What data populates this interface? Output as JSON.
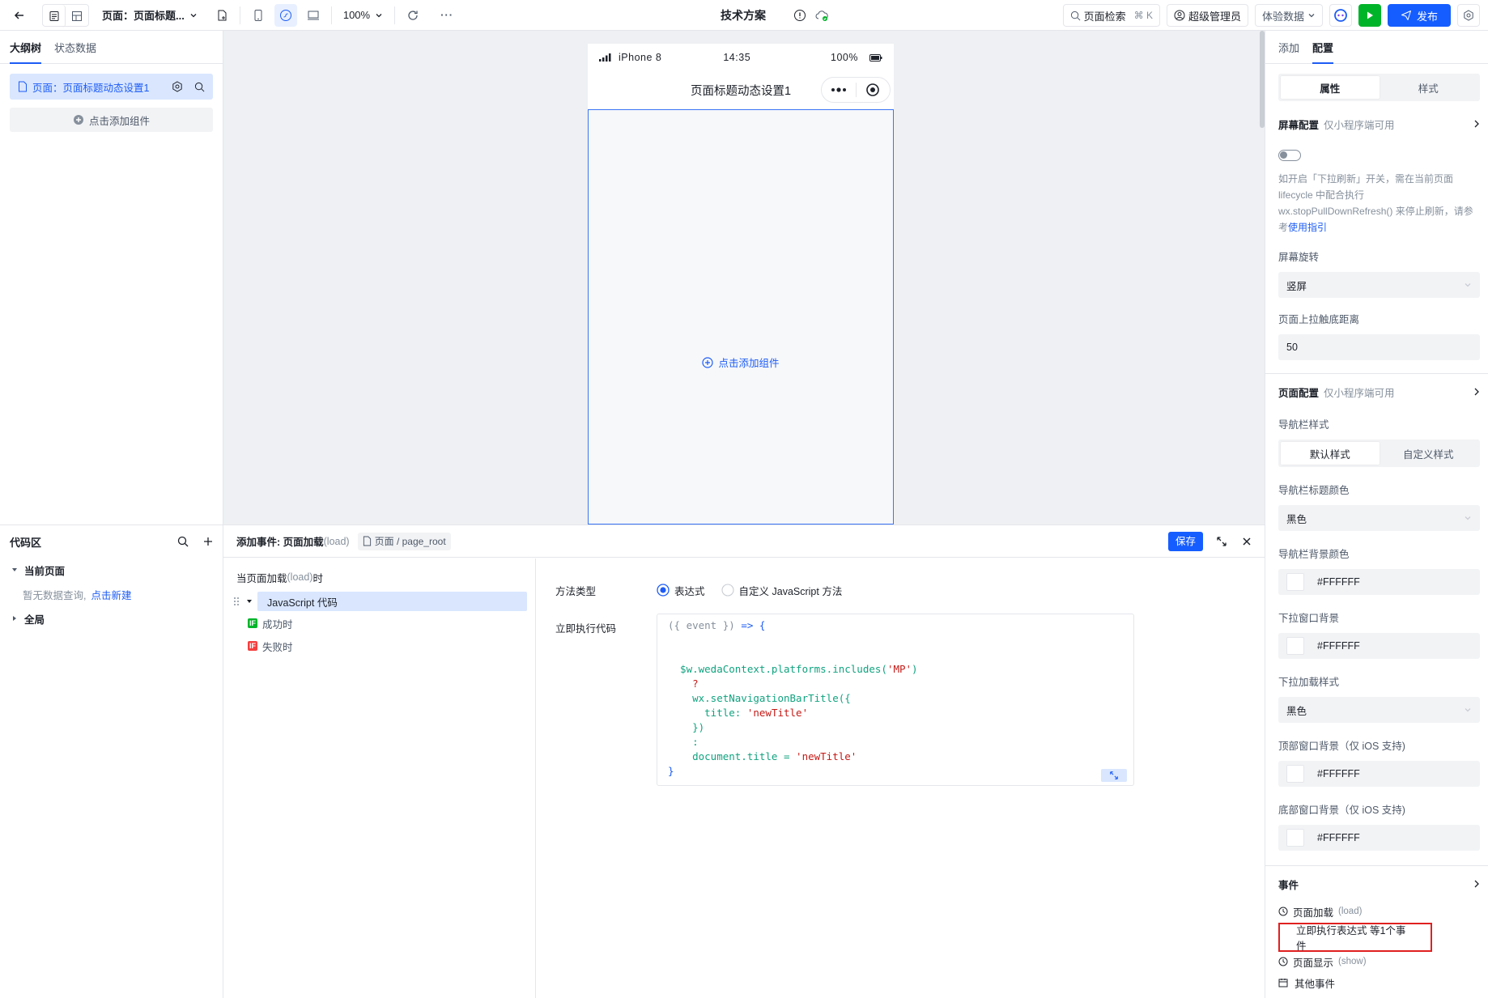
{
  "topbar": {
    "page_label": "页面：页面标题...",
    "zoom": "100%",
    "app_title": "技术方案",
    "search_label": "页面检索",
    "search_shortcut": "⌘ K",
    "user_label": "超级管理员",
    "env_label": "体验数据",
    "publish_label": "发布"
  },
  "left": {
    "tabs": [
      "大纲树",
      "状态数据"
    ],
    "page_item": "页面：页面标题动态设置1",
    "add_component": "点击添加组件",
    "code_title": "代码区",
    "current_page": "当前页面",
    "no_query": "暂无数据查询,",
    "create_new": "点击新建",
    "global": "全局"
  },
  "phone": {
    "device": "iPhone 8",
    "time": "14:35",
    "battery": "100%",
    "title": "页面标题动态设置1",
    "add_component": "点击添加组件"
  },
  "event_panel": {
    "title_prefix": "添加事件: 页面加载",
    "title_suffix": "(load)",
    "breadcrumb": "页面 / page_root",
    "save": "保存",
    "trigger_prefix": "当页面加载",
    "trigger_event": "(load)",
    "trigger_suffix": "时",
    "action": "JavaScript 代码",
    "success_badge": "IF",
    "success": "成功时",
    "fail_badge": "IF",
    "fail": "失败时",
    "method_label": "方法类型",
    "method_options": [
      "表达式",
      "自定义 JavaScript 方法"
    ],
    "code_label": "立即执行代码",
    "code_lines": [
      "({ event }) => {",
      "",
      "",
      "  $w.wedaContext.platforms.includes('MP')",
      "    ?",
      "    wx.setNavigationBarTitle({",
      "      title: 'newTitle'",
      "    })",
      "    :",
      "    document.title = 'newTitle'",
      "}"
    ]
  },
  "right": {
    "tabs": [
      "添加",
      "配置"
    ],
    "seg_tabs": [
      "属性",
      "样式"
    ],
    "screen_section": "屏幕配置",
    "mp_only": "仅小程序端可用",
    "help_text": "如开启「下拉刷新」开关，需在当前页面 lifecycle 中配合执行 wx.stopPullDownRefresh() 来停止刷新，请参考",
    "help_link": "使用指引",
    "rotate_label": "屏幕旋转",
    "rotate_value": "竖屏",
    "reach_bottom_label": "页面上拉触底距离",
    "reach_bottom_value": "50",
    "page_section": "页面配置",
    "nav_style_label": "导航栏样式",
    "nav_style_options": [
      "默认样式",
      "自定义样式"
    ],
    "nav_title_color_label": "导航栏标题颜色",
    "nav_title_color_value": "黑色",
    "nav_bg_label": "导航栏背景颜色",
    "nav_bg_value": "#FFFFFF",
    "pull_bg_label": "下拉窗口背景",
    "pull_bg_value": "#FFFFFF",
    "pull_style_label": "下拉加载样式",
    "pull_style_value": "黑色",
    "top_bg_label": "顶部窗口背景（仅 iOS 支持)",
    "top_bg_value": "#FFFFFF",
    "bottom_bg_label": "底部窗口背景（仅 iOS 支持)",
    "bottom_bg_value": "#FFFFFF",
    "events_section": "事件",
    "load_event": "页面加载",
    "load_event_en": "(load)",
    "load_event_summary": "立即执行表达式 等1个事件",
    "show_event": "页面显示",
    "show_event_en": "(show)",
    "other_events": "其他事件"
  },
  "colors": {
    "accent": "#1d5cf5",
    "publish_bg": "#165dff",
    "run_bg": "#00b42a",
    "highlight_box": "#e02020"
  }
}
